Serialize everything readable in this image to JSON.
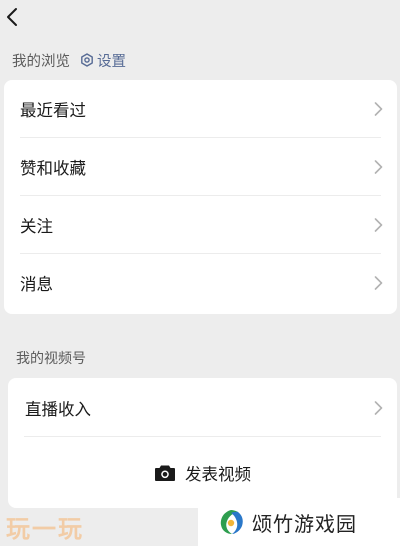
{
  "header": {
    "back_icon": "chevron-left-icon"
  },
  "browse_section": {
    "title": "我的浏览",
    "settings_label": "设置",
    "settings_icon": "gear-icon",
    "items": [
      {
        "label": "最近看过"
      },
      {
        "label": "赞和收藏"
      },
      {
        "label": "关注"
      },
      {
        "label": "消息"
      }
    ]
  },
  "channels_section": {
    "title": "我的视频号",
    "items": [
      {
        "label": "直播收入"
      }
    ],
    "publish_label": "发表视频",
    "publish_icon": "camera-icon"
  },
  "watermarks": {
    "left_text": "玩一玩",
    "right_text": "颂竹游戏园",
    "left_color": "#f3c79a"
  },
  "colors": {
    "link": "#576b95",
    "background": "#ededed"
  }
}
